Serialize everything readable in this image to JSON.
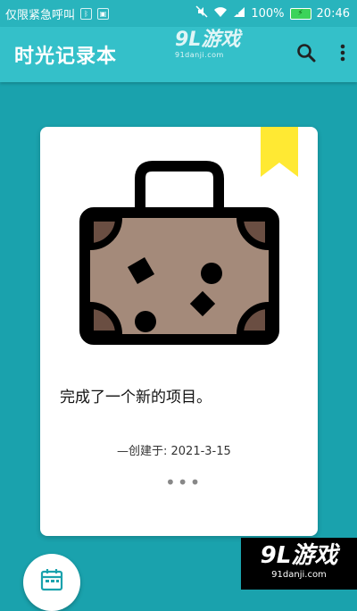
{
  "status_bar": {
    "carrier": "仅限紧急呼叫",
    "battery_percent": "100%",
    "time": "20:46"
  },
  "app_bar": {
    "title": "时光记录本",
    "search_icon": "search-icon",
    "more_icon": "more-vert-icon"
  },
  "card": {
    "text": "完成了一个新的项目。",
    "created_at": "—创建于: 2021-3-15",
    "more": "•••"
  },
  "watermarks": {
    "top_main": "9L游戏",
    "top_sub": "91danji.com",
    "bottom_main": "9L游戏",
    "bottom_sub": "91danji.com"
  },
  "fab": {
    "icon": "calendar-icon"
  },
  "colors": {
    "background": "#1aa2ad",
    "app_bar": "#34c0c9",
    "bookmark": "#ffe933",
    "suitcase_fill": "#a48a7a"
  }
}
